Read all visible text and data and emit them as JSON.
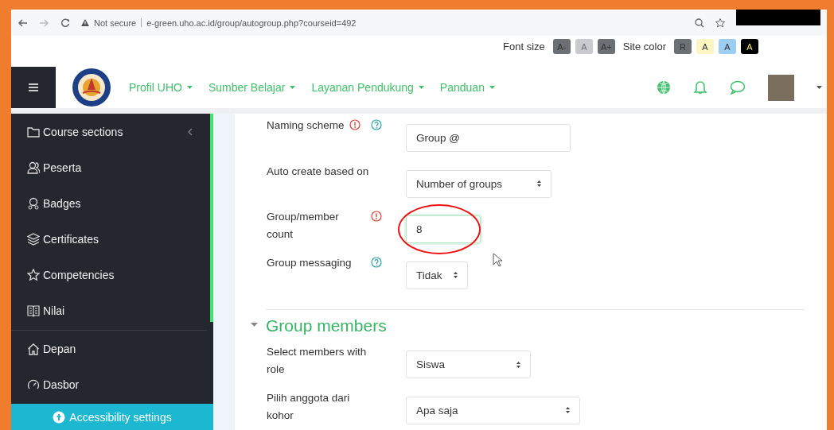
{
  "browser": {
    "security": "Not secure",
    "url": "e-green.uho.ac.id/group/autogroup.php?courseid=492"
  },
  "toolbar": {
    "font_size_label": "Font size",
    "font_buttons": [
      {
        "label": "A-",
        "disabled": false
      },
      {
        "label": "A",
        "disabled": true
      },
      {
        "label": "A+",
        "disabled": false
      }
    ],
    "site_color_label": "Site color",
    "color_buttons": [
      {
        "label": "R",
        "color": "#6b7075"
      },
      {
        "label": "A",
        "color": "#fdf6c3"
      },
      {
        "label": "A",
        "color": "#9ccdf3"
      },
      {
        "label": "A",
        "color": "#000000"
      }
    ]
  },
  "nav": {
    "menus": [
      "Profil UHO",
      "Sumber Belajar",
      "Layanan Pendukung",
      "Panduan"
    ]
  },
  "sidebar": {
    "course_items": [
      {
        "label": "Course sections",
        "collapsible": true
      },
      {
        "label": "Peserta",
        "collapsible": false
      },
      {
        "label": "Badges",
        "collapsible": false
      },
      {
        "label": "Certificates",
        "collapsible": false
      },
      {
        "label": "Competencies",
        "collapsible": false
      },
      {
        "label": "Nilai",
        "collapsible": false
      }
    ],
    "site_items": [
      {
        "label": "Depan",
        "collapsible": false
      },
      {
        "label": "Dasbor",
        "collapsible": false
      }
    ],
    "footer": "Accessibility settings"
  },
  "form": {
    "rows": [
      {
        "kind": "text",
        "label": "Naming scheme",
        "value": "Group @",
        "required": true,
        "help": true,
        "annotated": false
      },
      {
        "kind": "select",
        "label": "Auto create based on",
        "value": "Number of groups",
        "required": false,
        "help": false,
        "annotated": false
      },
      {
        "kind": "text",
        "label": "Group/member count",
        "value": "8",
        "required": true,
        "help": false,
        "annotated": true
      },
      {
        "kind": "select",
        "label": "Group messaging",
        "value": "Tidak",
        "required": false,
        "help": true,
        "annotated": false
      }
    ],
    "section": {
      "title": "Group members",
      "expanded": true
    },
    "section_rows": [
      {
        "kind": "select",
        "label": "Select members with role",
        "value": "Siswa",
        "required": false,
        "help": false,
        "annotated": false
      },
      {
        "kind": "select",
        "label": "Pilih anggota dari kohor",
        "value": "Apa saja",
        "required": false,
        "help": false,
        "annotated": false
      }
    ]
  }
}
